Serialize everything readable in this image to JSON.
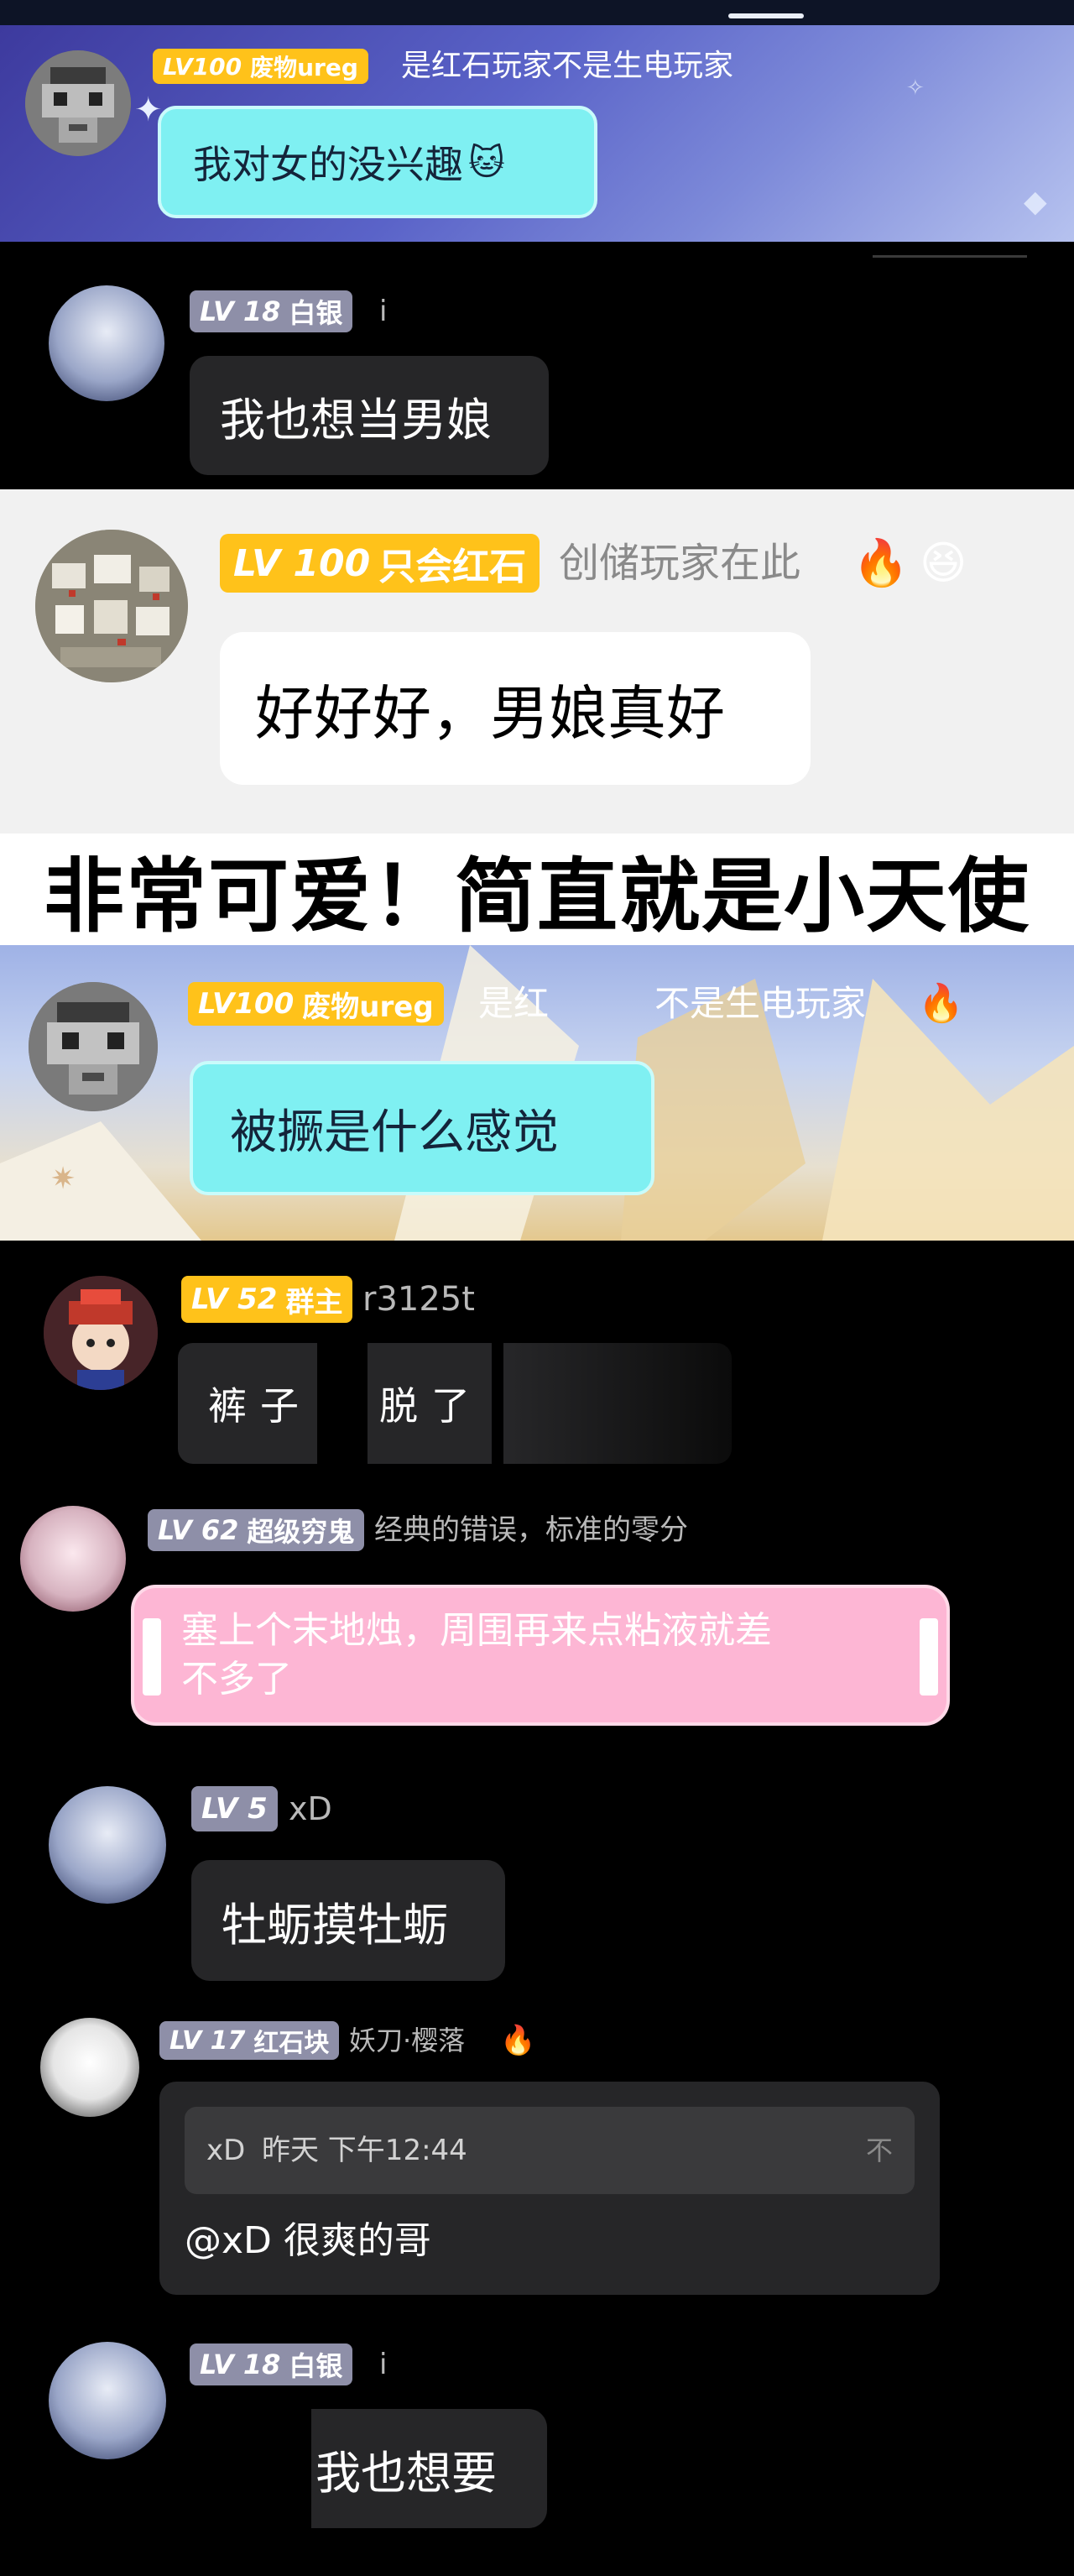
{
  "messages": {
    "m1": {
      "level": "LV100",
      "title": "废物ureg",
      "nickname": "是红石玩家不是生电玩家",
      "text": "我对女的没兴趣",
      "emoji": "🐱"
    },
    "m2": {
      "level": "LV 18",
      "title": "白银",
      "nickname": "i",
      "text": "我也想当男娘"
    },
    "m3": {
      "level": "LV 100",
      "title": "只会红石",
      "nickname": "创储玩家在此",
      "emoji_a": "🔥",
      "emoji_b": "😆",
      "text": "好好好，男娘真好"
    },
    "banner": "非常可爱！简直就是小天使",
    "m4": {
      "level": "LV100",
      "title": "废物ureg",
      "nickname_a": "是红",
      "nickname_b": "不是生电玩家",
      "emoji": "🔥",
      "text": "被撅是什么感觉"
    },
    "m5": {
      "level": "LV 52",
      "title": "群主",
      "nickname": "r3125t",
      "text_a": "裤子",
      "text_b": "脱了"
    },
    "m6": {
      "level": "LV 62",
      "title": "超级穷鬼",
      "nickname": "经典的错误，标准的零分",
      "text_line1": "塞上个末地烛，周围再来点粘液就差",
      "text_line2": "不多了"
    },
    "m7": {
      "level": "LV 5",
      "nickname": "xD",
      "text": "牡蛎摸牡蛎"
    },
    "m8": {
      "level": "LV 17",
      "title": "红石块",
      "nickname": "妖刀·樱落",
      "emoji": "🔥",
      "quote_author": "xD",
      "quote_time": "昨天 下午12:44",
      "quote_symbol": "不",
      "text": "@xD 很爽的哥"
    },
    "m9": {
      "level": "LV 18",
      "title": "白银",
      "nickname": "i",
      "text": "我也想要"
    }
  },
  "colors": {
    "gold_badge": "#ffc21a",
    "silver_badge": "#8e8fa8",
    "cyan_bubble": "#7ff0f2",
    "pink_bubble": "#fdb6d4",
    "dark_bubble": "#262628"
  },
  "icons": [
    "pixel-avatar-icon",
    "anime-avatar-icon",
    "fire-icon",
    "laugh-emoji-icon",
    "cat-emoji-icon",
    "sparkle-icon"
  ]
}
